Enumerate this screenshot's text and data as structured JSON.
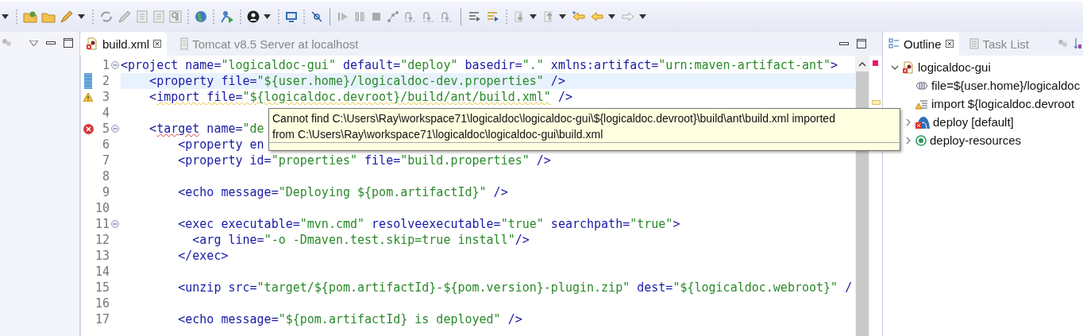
{
  "editor_tabs": [
    {
      "label": "build.xml",
      "selected": true,
      "kind": "xml"
    },
    {
      "label": "Tomcat v8.5 Server at localhost",
      "selected": false,
      "kind": "server"
    }
  ],
  "editor": {
    "lines": [
      {
        "number": "1",
        "fold": true,
        "tokens": [
          {
            "kind": "tag",
            "text": "<project"
          },
          {
            "kind": "attr",
            "text": " name="
          },
          {
            "kind": "value",
            "text": "\"logicaldoc-gui\""
          },
          {
            "kind": "attr",
            "text": " default="
          },
          {
            "kind": "value",
            "text": "\"deploy\""
          },
          {
            "kind": "attr",
            "text": " basedir="
          },
          {
            "kind": "value",
            "text": "\".\""
          },
          {
            "kind": "attr",
            "text": " xmlns:artifact="
          },
          {
            "kind": "value",
            "text": "\"urn:maven-artifact-ant\""
          },
          {
            "kind": "tag",
            "text": ">"
          }
        ]
      },
      {
        "number": "2",
        "changed": true,
        "current": true,
        "tokens": [
          {
            "kind": "tag",
            "text": "    <property"
          },
          {
            "kind": "attr",
            "text": " file="
          },
          {
            "kind": "value",
            "text": "\"${user.home}/logicaldoc-dev.properties\""
          },
          {
            "kind": "tag",
            "text": " />"
          }
        ]
      },
      {
        "number": "3",
        "warning": true,
        "tokens": [
          {
            "kind": "tag",
            "text": "    <"
          },
          {
            "kind": "tag",
            "text": "import",
            "warning": true
          },
          {
            "kind": "attr",
            "text": " file=",
            "warning": true
          },
          {
            "kind": "value",
            "text": "\"${logicaldoc.devroot}/build/ant/build.xml\"",
            "warning": true
          },
          {
            "kind": "tag",
            "text": " />"
          }
        ]
      },
      {
        "number": "4"
      },
      {
        "number": "5",
        "fold": true,
        "error": true,
        "tokens": [
          {
            "kind": "tag",
            "text": "    <"
          },
          {
            "kind": "tag",
            "text": "target",
            "error": true
          },
          {
            "kind": "attr",
            "text": " name="
          },
          {
            "kind": "value",
            "text": "\"de"
          }
        ]
      },
      {
        "number": "6",
        "tokens": [
          {
            "kind": "tag",
            "text": "        <property"
          },
          {
            "kind": "attr",
            "text": " en"
          }
        ]
      },
      {
        "number": "7",
        "tokens": [
          {
            "kind": "tag",
            "text": "        <property"
          },
          {
            "kind": "attr",
            "text": " id="
          },
          {
            "kind": "value",
            "text": "\"properties\""
          },
          {
            "kind": "attr",
            "text": " file="
          },
          {
            "kind": "value",
            "text": "\"build.properties\""
          },
          {
            "kind": "tag",
            "text": " />"
          }
        ]
      },
      {
        "number": "8"
      },
      {
        "number": "9",
        "tokens": [
          {
            "kind": "tag",
            "text": "        <echo"
          },
          {
            "kind": "attr",
            "text": " message="
          },
          {
            "kind": "value",
            "text": "\"Deploying ${pom.artifactId}\""
          },
          {
            "kind": "tag",
            "text": " />"
          }
        ]
      },
      {
        "number": "10"
      },
      {
        "number": "11",
        "fold": true,
        "tokens": [
          {
            "kind": "tag",
            "text": "        <exec"
          },
          {
            "kind": "attr",
            "text": " executable="
          },
          {
            "kind": "value",
            "text": "\"mvn.cmd\""
          },
          {
            "kind": "attr",
            "text": " resolveexecutable="
          },
          {
            "kind": "value",
            "text": "\"true\""
          },
          {
            "kind": "attr",
            "text": " searchpath="
          },
          {
            "kind": "value",
            "text": "\"true\""
          },
          {
            "kind": "tag",
            "text": ">"
          }
        ]
      },
      {
        "number": "12",
        "tokens": [
          {
            "kind": "tag",
            "text": "          <arg"
          },
          {
            "kind": "attr",
            "text": " line="
          },
          {
            "kind": "value",
            "text": "\"-o -Dmaven.test.skip=true install\""
          },
          {
            "kind": "tag",
            "text": "/>"
          }
        ]
      },
      {
        "number": "13",
        "tokens": [
          {
            "kind": "tag",
            "text": "        </exec>"
          }
        ]
      },
      {
        "number": "14"
      },
      {
        "number": "15",
        "tokens": [
          {
            "kind": "tag",
            "text": "        <unzip"
          },
          {
            "kind": "attr",
            "text": " src="
          },
          {
            "kind": "value",
            "text": "\"target/${pom.artifactId}-${pom.version}-plugin.zip\""
          },
          {
            "kind": "attr",
            "text": " dest="
          },
          {
            "kind": "value",
            "text": "\"${logicaldoc.webroot}\""
          },
          {
            "kind": "tag",
            "text": " /"
          }
        ]
      },
      {
        "number": "16"
      },
      {
        "number": "17",
        "tokens": [
          {
            "kind": "tag",
            "text": "        <echo"
          },
          {
            "kind": "attr",
            "text": " message="
          },
          {
            "kind": "value",
            "text": "\"${pom.artifactId} is deployed\""
          },
          {
            "kind": "tag",
            "text": " />"
          }
        ]
      }
    ]
  },
  "tooltip": {
    "lines": [
      "Cannot find C:\\Users\\Ray\\workspace71\\logicaldoc\\logicaldoc-gui\\${logicaldoc.devroot}\\build\\ant\\build.xml imported",
      "from C:\\Users\\Ray\\workspace71\\logicaldoc\\logicaldoc-gui\\build.xml"
    ]
  },
  "side_tabs": [
    {
      "label": "Outline",
      "selected": true,
      "kind": "outline"
    },
    {
      "label": "Task List",
      "selected": false,
      "kind": "tasks"
    }
  ],
  "outline": [
    {
      "label": "logicaldoc-gui",
      "kind": "project",
      "expanded": true,
      "children": [
        {
          "label": "file=${user.home}/logicaldoc",
          "kind": "property"
        },
        {
          "label": "import ${logicaldoc.devroot",
          "kind": "import"
        },
        {
          "label": "deploy [default]",
          "kind": "target-error",
          "expanded": false
        },
        {
          "label": "deploy-resources",
          "kind": "target",
          "expanded": false
        }
      ]
    }
  ]
}
